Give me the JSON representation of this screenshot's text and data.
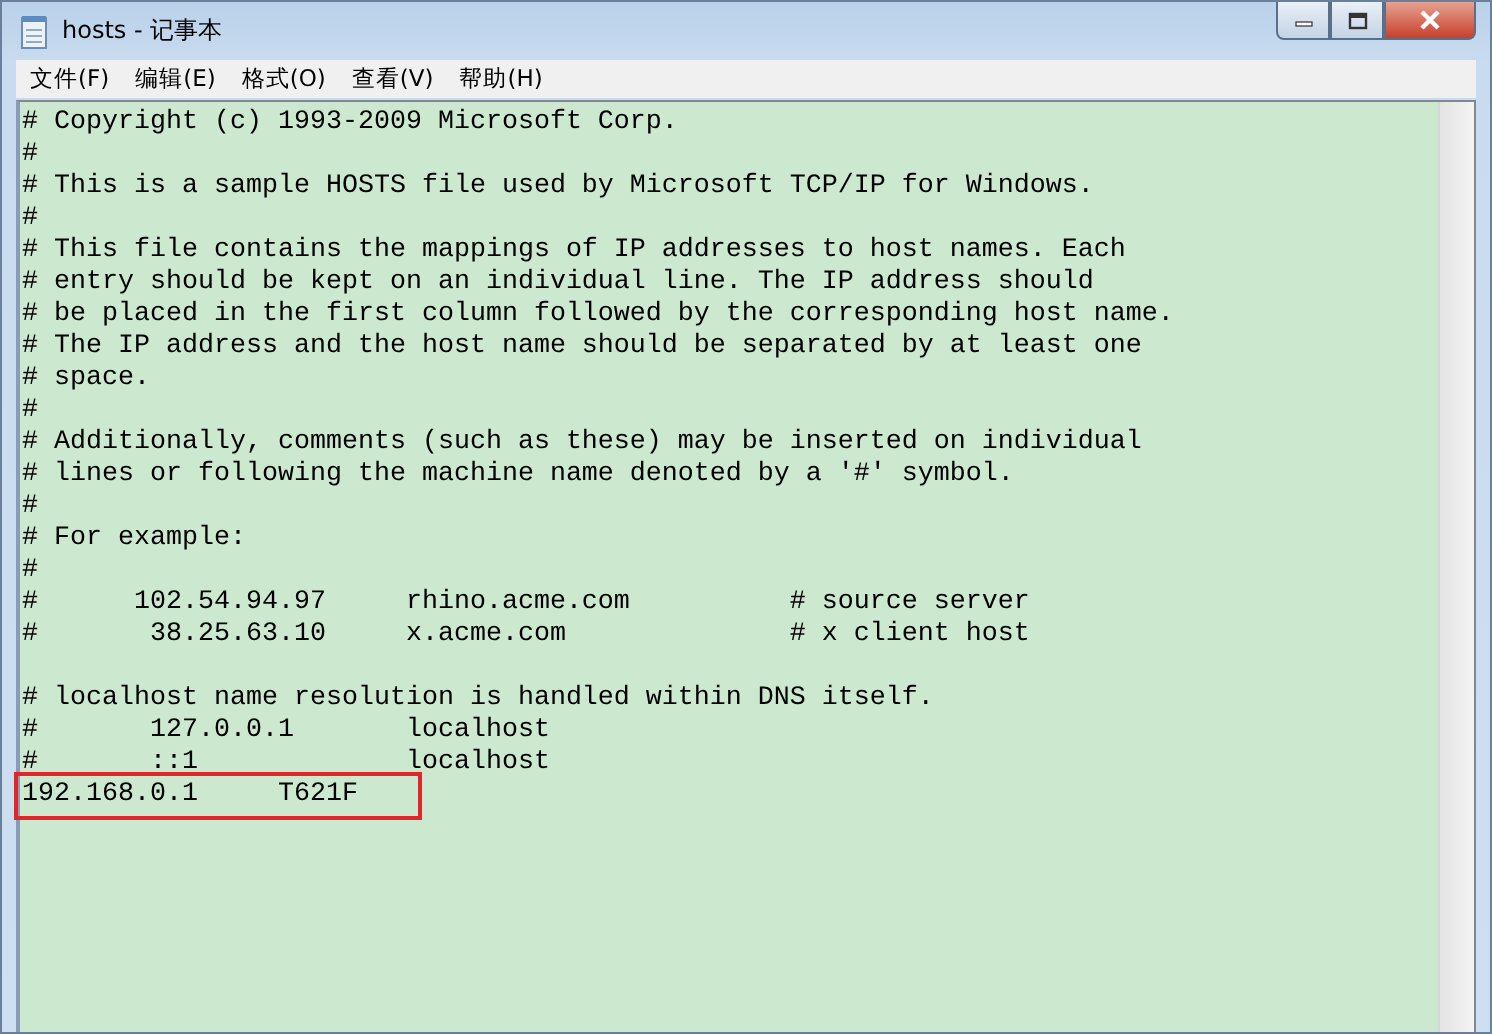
{
  "window": {
    "title": "hosts - 记事本"
  },
  "menu": [
    {
      "label": "文件(F)"
    },
    {
      "label": "编辑(E)"
    },
    {
      "label": "格式(O)"
    },
    {
      "label": "查看(V)"
    },
    {
      "label": "帮助(H)"
    }
  ],
  "editor": {
    "lines": [
      {
        "text": "# Copyright (c) 1993-2009 Microsoft Corp.",
        "highlighted": false
      },
      {
        "text": "#",
        "highlighted": false
      },
      {
        "text": "# This is a sample HOSTS file used by Microsoft TCP/IP for Windows.",
        "highlighted": false
      },
      {
        "text": "#",
        "highlighted": false
      },
      {
        "text": "# This file contains the mappings of IP addresses to host names. Each",
        "highlighted": false
      },
      {
        "text": "# entry should be kept on an individual line. The IP address should",
        "highlighted": false
      },
      {
        "text": "# be placed in the first column followed by the corresponding host name.",
        "highlighted": false
      },
      {
        "text": "# The IP address and the host name should be separated by at least one",
        "highlighted": false
      },
      {
        "text": "# space.",
        "highlighted": false
      },
      {
        "text": "#",
        "highlighted": false
      },
      {
        "text": "# Additionally, comments (such as these) may be inserted on individual",
        "highlighted": false
      },
      {
        "text": "# lines or following the machine name denoted by a '#' symbol.",
        "highlighted": false
      },
      {
        "text": "#",
        "highlighted": false
      },
      {
        "text": "# For example:",
        "highlighted": false
      },
      {
        "text": "#",
        "highlighted": false
      },
      {
        "text": "#      102.54.94.97     rhino.acme.com          # source server",
        "highlighted": false
      },
      {
        "text": "#       38.25.63.10     x.acme.com              # x client host",
        "highlighted": false
      },
      {
        "highlighted": false
      },
      {
        "text": "# localhost name resolution is handled within DNS itself.",
        "highlighted": false
      },
      {
        "text": "#       127.0.0.1       localhost",
        "highlighted": false
      },
      {
        "text": "#       ::1             localhost",
        "highlighted": false
      },
      {
        "text": "192.168.0.1     T621F",
        "highlighted": true
      }
    ]
  }
}
